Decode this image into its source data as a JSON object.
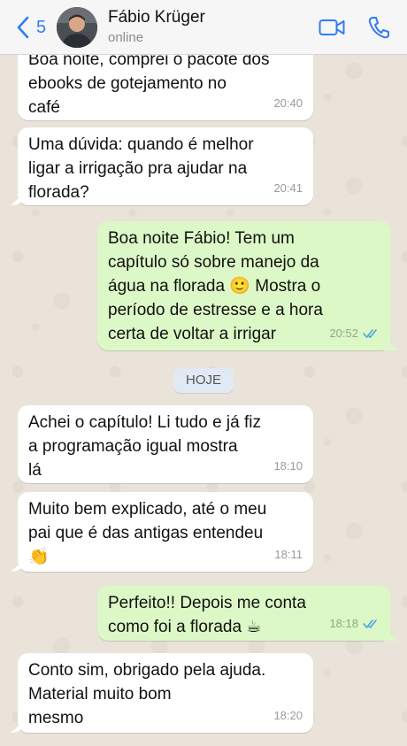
{
  "header": {
    "back_count": "5",
    "contact_name": "Fábio Krüger",
    "status": "online",
    "icons": {
      "back": "chevron-left-icon",
      "video": "video-call-icon",
      "call": "phone-icon"
    },
    "accent_color": "#2f7cf6"
  },
  "messages": [
    {
      "dir": "in",
      "text": "Boa noite, comprei o pacote dos\nebooks de gotejamento no\ncafé",
      "time": "20:40"
    },
    {
      "dir": "in",
      "text": "Uma dúvida: quando é melhor\nligar a irrigação pra ajudar na\nflorada?",
      "time": "20:41"
    },
    {
      "dir": "out",
      "text": "Boa noite Fábio! Tem um\ncapítulo só sobre manejo da\nágua na florada 🙂  Mostra o\nperíodo de estresse e a hora\ncerta de voltar a irrigar",
      "time": "20:52"
    },
    {
      "dir": "in",
      "text": "Achei o capítulo! Li tudo e já fiz\na programação igual mostra\nlá",
      "time": "18:10"
    },
    {
      "dir": "in",
      "text": "Muito bem explicado, até o meu\npai que é das antigas entendeu\n👏",
      "time": "18:11"
    },
    {
      "dir": "out",
      "text": "Perfeito!! Depois me conta\ncomo foi a florada ☕",
      "time": "18:18"
    },
    {
      "dir": "in",
      "text": "Conto sim, obrigado pela ajuda.\nMaterial muito bom\nmesmo",
      "time": "18:20"
    }
  ],
  "day_separator": "HOJE",
  "colors": {
    "incoming": "#ffffff",
    "outgoing": "#dcf8c6",
    "read_ticks": "#4fa3e0"
  }
}
